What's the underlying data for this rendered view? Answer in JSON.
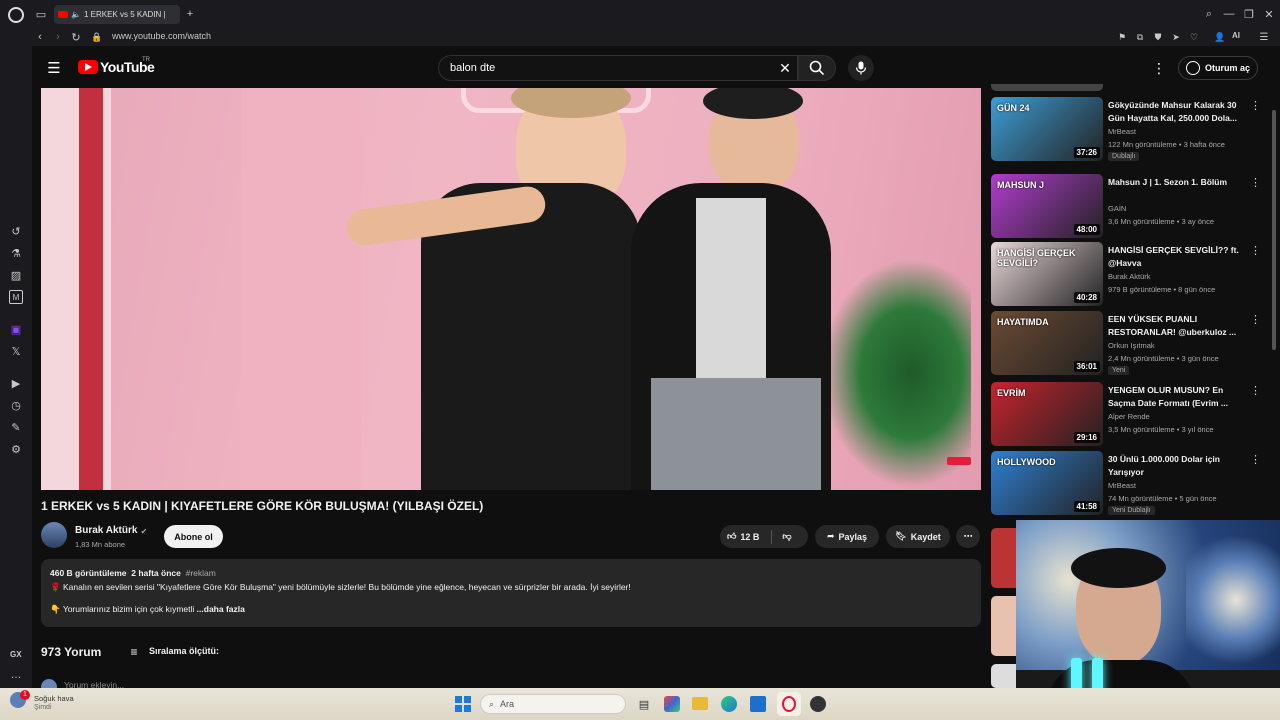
{
  "browser": {
    "tab_title": "1 ERKEK vs 5 KADIN |",
    "url": "www.youtube.com/watch",
    "aria_label": "AI",
    "sidebar_gx": "GX"
  },
  "youtube": {
    "logo": "YouTube",
    "region": "TR",
    "search_value": "balon dte",
    "signin_label": "Oturum aç"
  },
  "video": {
    "title": "1 ERKEK vs 5 KADIN | KIYAFETLERE GÖRE KÖR BULUŞMA! (YILBAŞI ÖZEL)",
    "channel": "Burak Aktürk",
    "subscribers": "1,83 Mn abone",
    "subscribe_label": "Abone ol",
    "likes": "12 B",
    "share_label": "Paylaş",
    "save_label": "Kaydet"
  },
  "description": {
    "views": "460 B görüntüleme",
    "date": "2 hafta önce",
    "hashtag": "#reklam",
    "line1": "Kanalın en sevilen serisi \"Kıyafetlere Göre Kör Buluşma\" yeni bölümüyle sizlerle! Bu bölümde yine eğlence, heyecan ve sürprizler bir arada. İyi seyirler!",
    "line2": "Yorumlarınız bizim için çok kıymetli",
    "more_label": "...daha fazla"
  },
  "comments": {
    "count": "973 Yorum",
    "sort_label": "Sıralama ölçütü:",
    "add_placeholder": "Yorum ekleyin..."
  },
  "recommendations": [
    {
      "title": "Gökyüzünde Mahsur Kalarak 30 Gün Hayatta Kal, 250.000 Dola...",
      "channel": "MrBeast",
      "meta": "122 Mn görüntüleme • 3 hafta önce",
      "badge": "Dublajlı",
      "duration": "37:26",
      "color": "#3d9dd6"
    },
    {
      "title": "Mahsun J | 1. Sezon 1. Bölüm",
      "channel": "GAİN",
      "meta": "3,6 Mn görüntüleme • 3 ay önce",
      "badge": "",
      "duration": "48:00",
      "color": "#b23ccf"
    },
    {
      "title": "HANGİSİ GERÇEK SEVGİLİ?? ft. @Havva",
      "channel": "Burak Aktürk",
      "meta": "979 B görüntüleme • 8 gün önce",
      "badge": "",
      "duration": "40:28",
      "color": "#e8d7d9"
    },
    {
      "title": "EEN YÜKSEK PUANLI RESTORANLAR! @uberkuloz ...",
      "channel": "Orkun Işıtmak",
      "meta": "2,4 Mn görüntüleme • 3 gün önce",
      "badge": "Yeni",
      "duration": "36:01",
      "color": "#6d4a33"
    },
    {
      "title": "YENGEM OLUR MUSUN? En Saçma Date Formatı (Evrim ...",
      "channel": "Alper Rende",
      "meta": "3,5 Mn görüntüleme • 3 yıl önce",
      "badge": "",
      "duration": "29:16",
      "color": "#c8232c"
    },
    {
      "title": "30 Ünlü 1.000.000 Dolar için Yarışıyor",
      "channel": "MrBeast",
      "meta": "74 Mn görüntüleme • 5 gün önce",
      "badge": "Yeni   Dublajlı",
      "duration": "41:58",
      "color": "#2f7fd4"
    }
  ],
  "thumb_texts": [
    "GÜN 24",
    "MAHSUN J",
    "HANGİSİ GERÇEK SEVGİLİ?",
    "HAYATIMDA",
    "EVRİM",
    "HOLLYWOOD"
  ],
  "taskbar": {
    "weather_title": "Soğuk hava",
    "weather_sub": "Şimdi",
    "search_placeholder": "Ara"
  }
}
